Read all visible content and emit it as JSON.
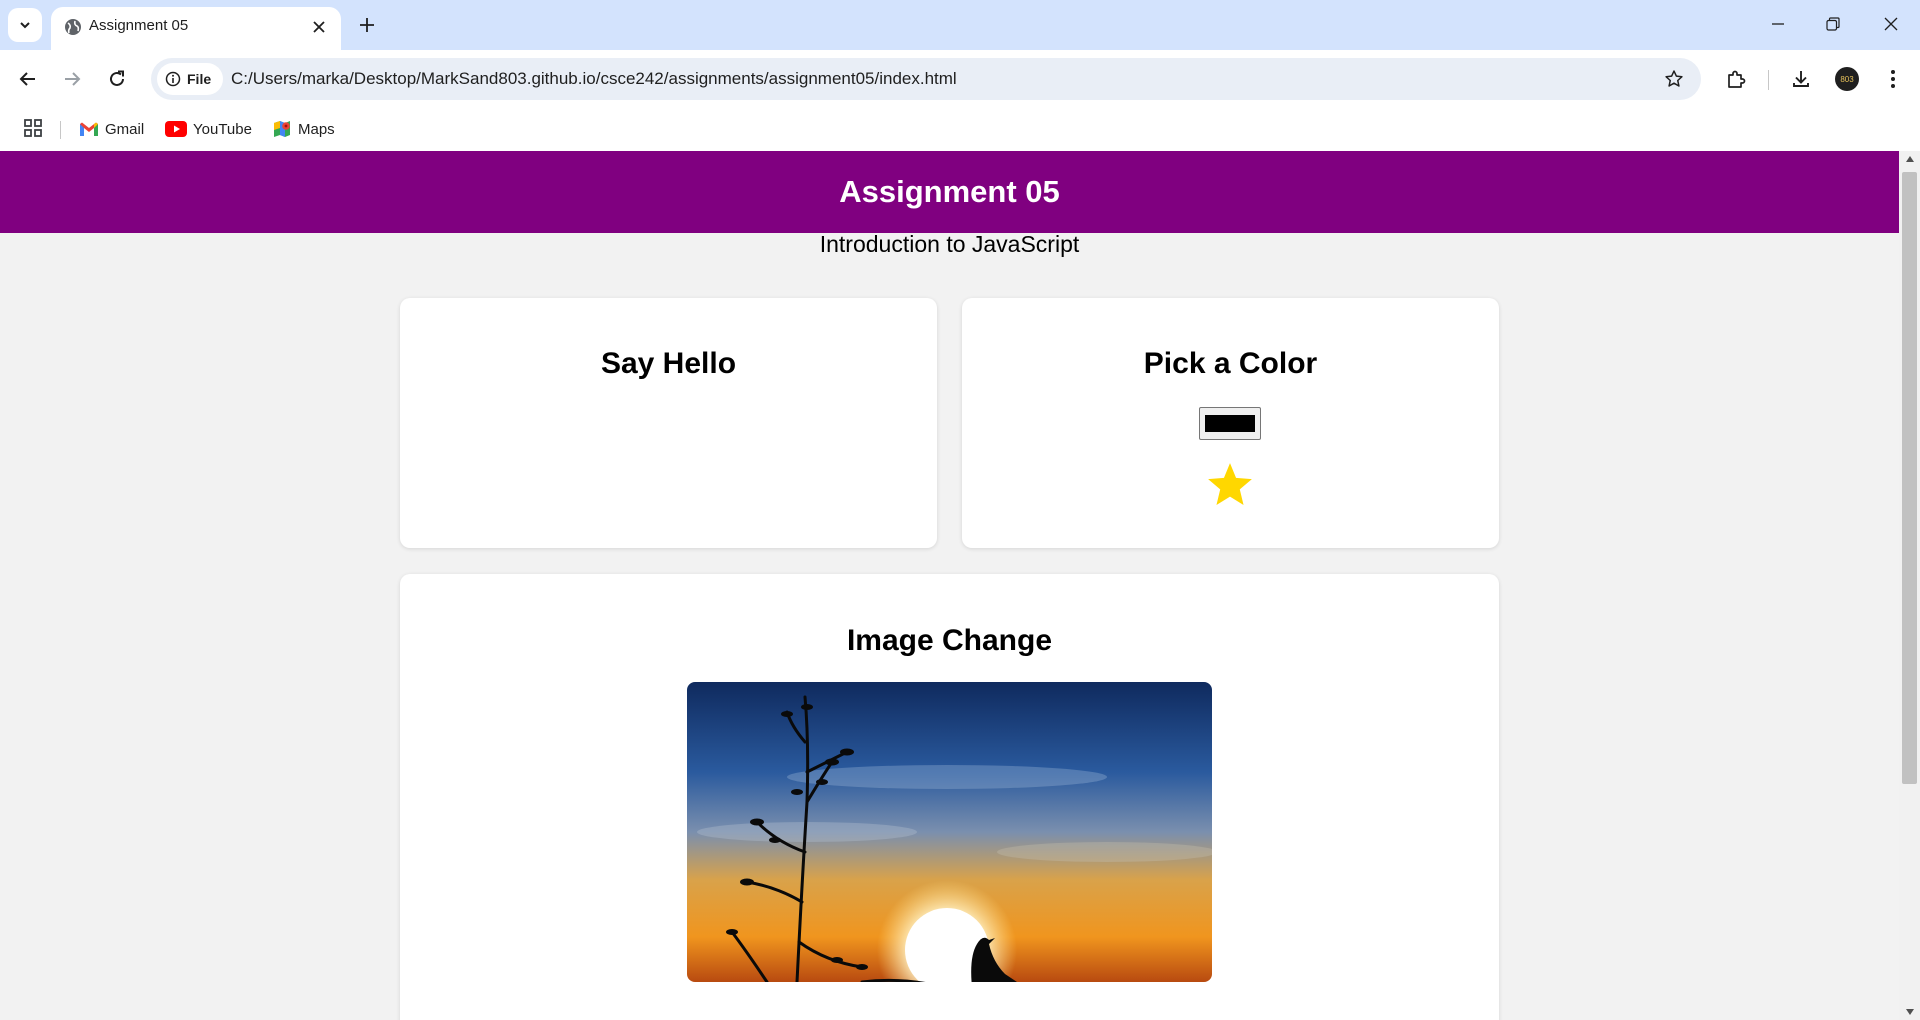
{
  "browser": {
    "tab_title": "Assignment 05",
    "site_chip_label": "File",
    "url": "C:/Users/marka/Desktop/MarkSand803.github.io/csce242/assignments/assignment05/index.html",
    "avatar_text": "803",
    "bookmarks": [
      {
        "label": "Gmail",
        "icon": "gmail-icon"
      },
      {
        "label": "YouTube",
        "icon": "youtube-icon"
      },
      {
        "label": "Maps",
        "icon": "maps-icon"
      }
    ]
  },
  "page": {
    "header_title": "Assignment 05",
    "subtitle": "Introduction to JavaScript",
    "header_color": "#800080",
    "cards": {
      "say_hello": {
        "title": "Say Hello"
      },
      "pick_color": {
        "title": "Pick a Color",
        "selected_color": "#000000",
        "star_color": "#FFD700"
      },
      "image_change": {
        "title": "Image Change",
        "image": "sunset-bird-silhouette"
      }
    }
  }
}
